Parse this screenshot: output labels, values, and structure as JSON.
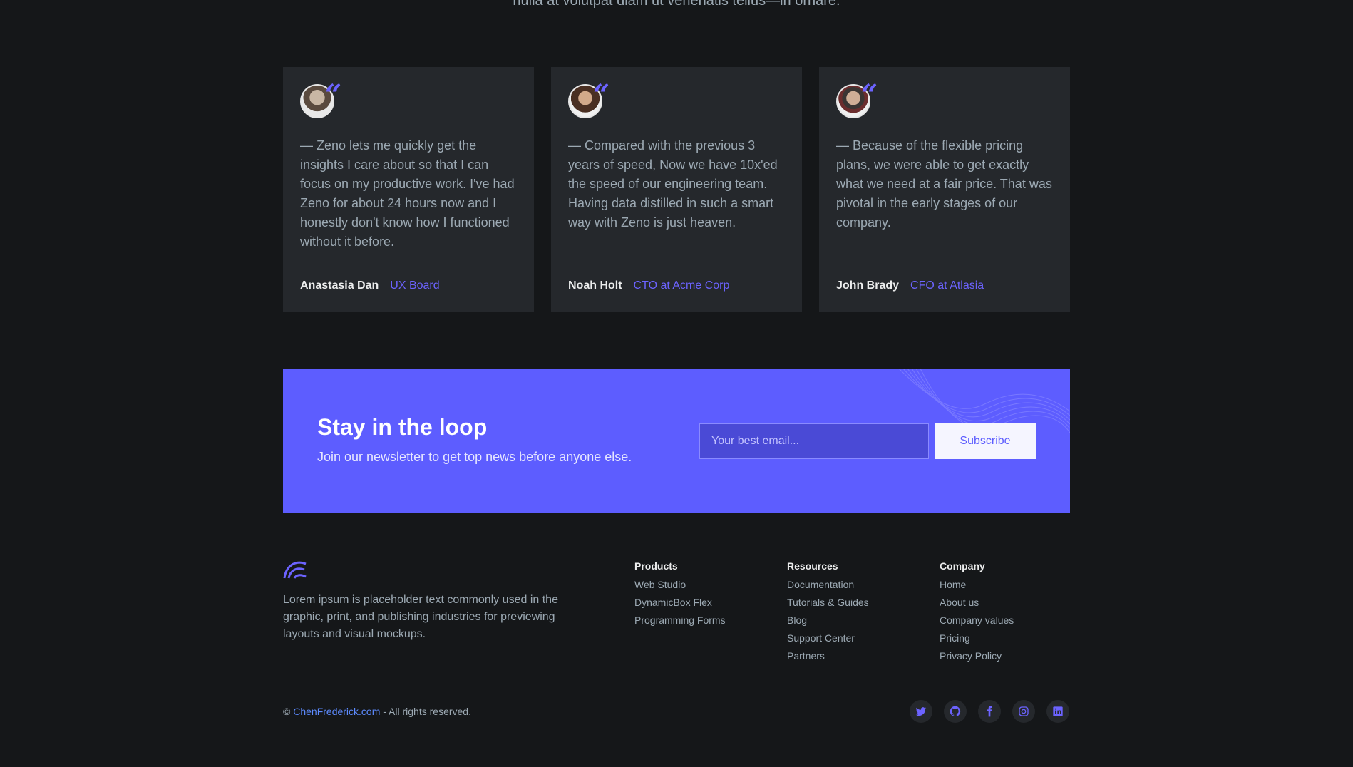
{
  "intro": {
    "text": "nulla at volutpat diam ut venenatis tellus—in ornare."
  },
  "testimonials": [
    {
      "quote": "— Zeno lets me quickly get the insights I care about so that I can focus on my productive work. I've had Zeno for about 24 hours now and I honestly don't know how I functioned without it before.",
      "name": "Anastasia Dan",
      "role": "UX Board"
    },
    {
      "quote": "— Compared with the previous 3 years of speed, Now we have 10x'ed the speed of our engineering team. Having data distilled in such a smart way with Zeno is just heaven.",
      "name": "Noah Holt",
      "role": "CTO at Acme Corp"
    },
    {
      "quote": "— Because of the flexible pricing plans, we were able to get exactly what we need at a fair price. That was pivotal in the early stages of our company.",
      "name": "John Brady",
      "role": "CFO at Atlasia"
    }
  ],
  "newsletter": {
    "title": "Stay in the loop",
    "subtitle": "Join our newsletter to get top news before anyone else.",
    "placeholder": "Your best email...",
    "button": "Subscribe",
    "bg_color": "#5d5dff"
  },
  "footer": {
    "description": "Lorem ipsum is placeholder text commonly used in the graphic, print, and publishing industries for previewing layouts and visual mockups.",
    "columns": [
      {
        "title": "Products",
        "items": [
          "Web Studio",
          "DynamicBox Flex",
          "Programming Forms"
        ]
      },
      {
        "title": "Resources",
        "items": [
          "Documentation",
          "Tutorials & Guides",
          "Blog",
          "Support Center",
          "Partners"
        ]
      },
      {
        "title": "Company",
        "items": [
          "Home",
          "About us",
          "Company values",
          "Pricing",
          "Privacy Policy"
        ]
      }
    ],
    "copyright_prefix": "©",
    "copyright_link": "ChenFrederick.com",
    "copyright_suffix": "- All rights reserved.",
    "socials": [
      "twitter-icon",
      "github-icon",
      "facebook-icon",
      "instagram-icon",
      "linkedin-icon"
    ]
  },
  "colors": {
    "accent": "#6c63ff",
    "background": "#151719",
    "card": "#25282c"
  }
}
